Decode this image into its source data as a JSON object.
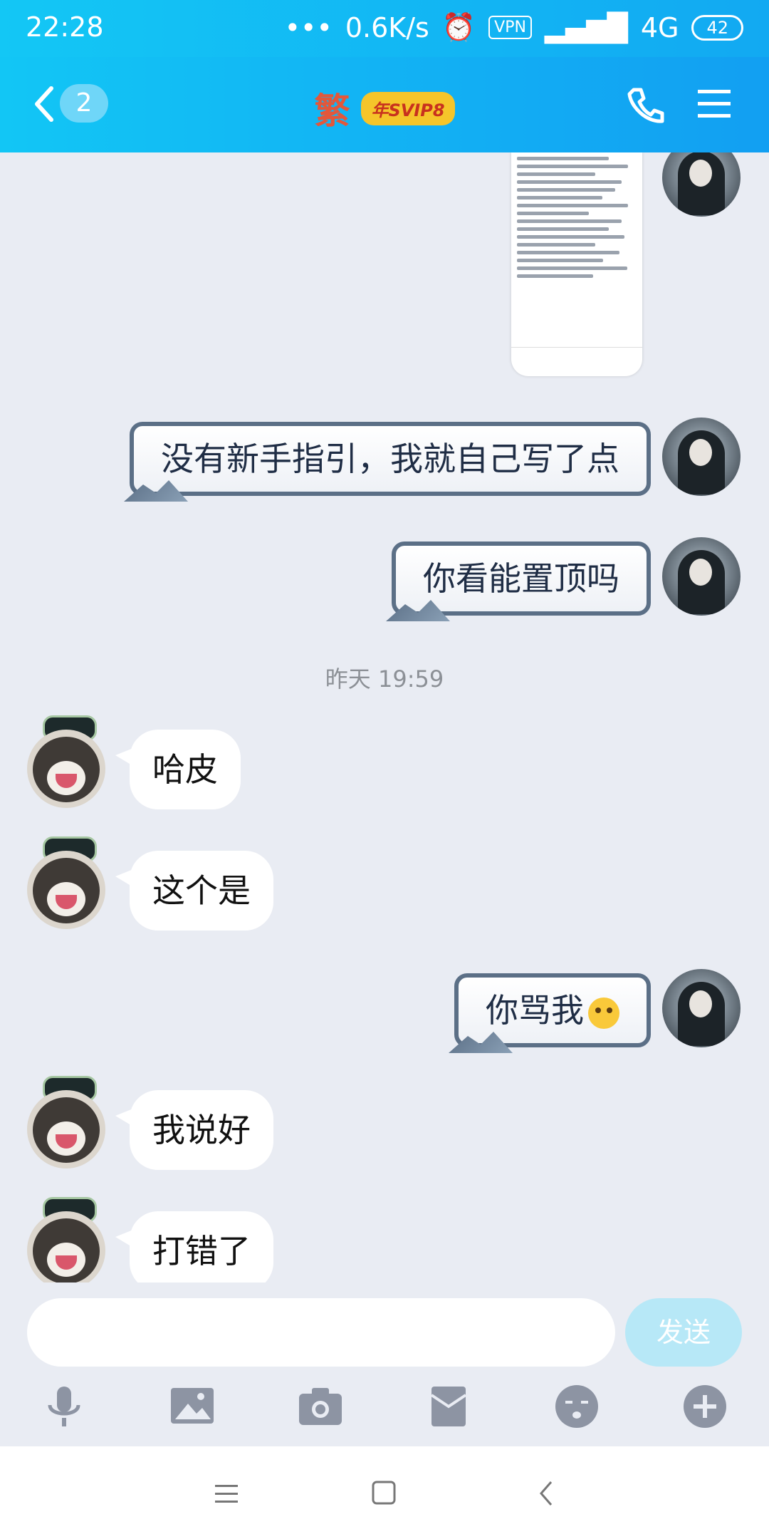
{
  "status_bar": {
    "time": "22:28",
    "network_speed": "0.6K/s",
    "vpn": "VPN",
    "signal": "4G",
    "battery": "42"
  },
  "header": {
    "unread_count": "2",
    "title": "繁",
    "vip_badge": "年SVIP8"
  },
  "messages": [
    {
      "from": "me",
      "type": "image"
    },
    {
      "from": "me",
      "text": "没有新手指引，我就自己写了点"
    },
    {
      "from": "me",
      "text": "你看能置顶吗"
    },
    {
      "type": "timestamp",
      "text": "昨天 19:59"
    },
    {
      "from": "other",
      "text": "哈皮"
    },
    {
      "from": "other",
      "text": "这个是"
    },
    {
      "from": "me",
      "text": "你骂我"
    },
    {
      "from": "other",
      "text": "我说好"
    },
    {
      "from": "other",
      "text": "打错了"
    }
  ],
  "input": {
    "placeholder": "",
    "send_label": "发送"
  },
  "toolbar": {
    "icons": [
      "microphone-icon",
      "image-icon",
      "camera-icon",
      "red-packet-icon",
      "emoji-icon",
      "plus-icon"
    ]
  },
  "colors": {
    "header_gradient_start": "#12c6f5",
    "header_gradient_end": "#129ff2",
    "chat_background": "#e9ecf3",
    "send_button": "#b7e8f7"
  }
}
